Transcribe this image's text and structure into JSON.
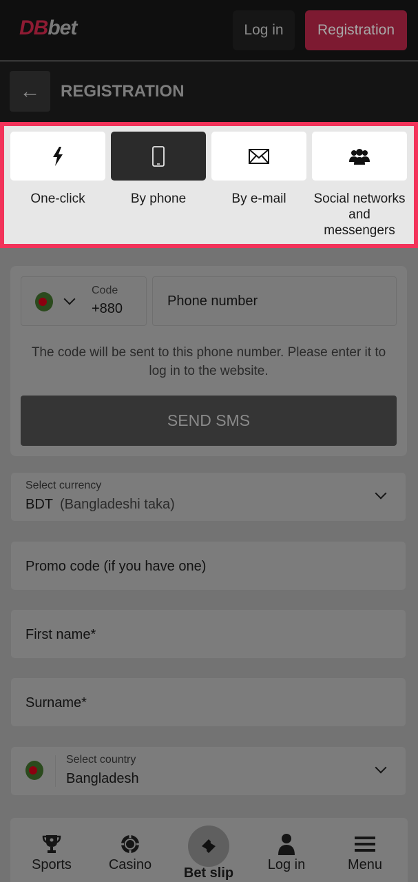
{
  "header": {
    "logo_primary": "DB",
    "logo_secondary": "bet",
    "login_label": "Log in",
    "registration_label": "Registration"
  },
  "subheader": {
    "back_icon": "arrow-left-icon",
    "title": "REGISTRATION"
  },
  "reg_tabs": [
    {
      "label": "One-click",
      "icon": "lightning-icon",
      "active": false
    },
    {
      "label": "By phone",
      "icon": "smartphone-icon",
      "active": true
    },
    {
      "label": "By e-mail",
      "icon": "envelope-icon",
      "active": false
    },
    {
      "label": "Social networks and messengers",
      "icon": "users-icon",
      "active": false
    }
  ],
  "phone_form": {
    "country_code_label": "Code",
    "country_code_value": "+880",
    "phone_placeholder": "Phone number",
    "hint": "The code will be sent to this phone number. Please enter it to log in to the website.",
    "send_sms_label": "SEND SMS"
  },
  "currency": {
    "label": "Select currency",
    "code": "BDT",
    "name": "(Bangladeshi taka)"
  },
  "promo": {
    "placeholder": "Promo code (if you have one)"
  },
  "first_name": {
    "placeholder": "First name*"
  },
  "surname": {
    "placeholder": "Surname*"
  },
  "country": {
    "label": "Select country",
    "value": "Bangladesh"
  },
  "bottom_nav": {
    "sports": "Sports",
    "casino": "Casino",
    "betslip": "Bet slip",
    "login": "Log in",
    "menu": "Menu"
  },
  "colors": {
    "brand_red": "#8e1b33",
    "highlight_border": "#f2335a",
    "active_tab": "#2b2b2b"
  }
}
